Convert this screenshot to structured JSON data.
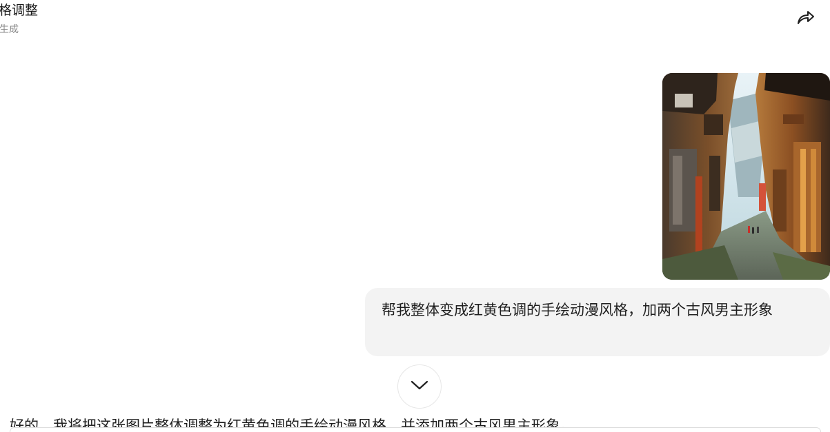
{
  "header": {
    "title": "格调整",
    "subtitle": "生成"
  },
  "icons": {
    "share": "share-arrow-icon",
    "scroll_down": "chevron-down-icon"
  },
  "conversation": {
    "user_message": "帮我整体变成红黄色调的手绘动漫风格，加两个古风男主形象",
    "assistant_message": "好的，我将把这张图片整体调整为红黄色调的手绘动漫风格，并添加两个古风男主形象。"
  },
  "photo": {
    "alt": "ancient-town-street-photo"
  },
  "colors": {
    "bubble_bg": "#f3f3f3",
    "text": "#1f1f1f",
    "muted": "#8a8a8a"
  }
}
